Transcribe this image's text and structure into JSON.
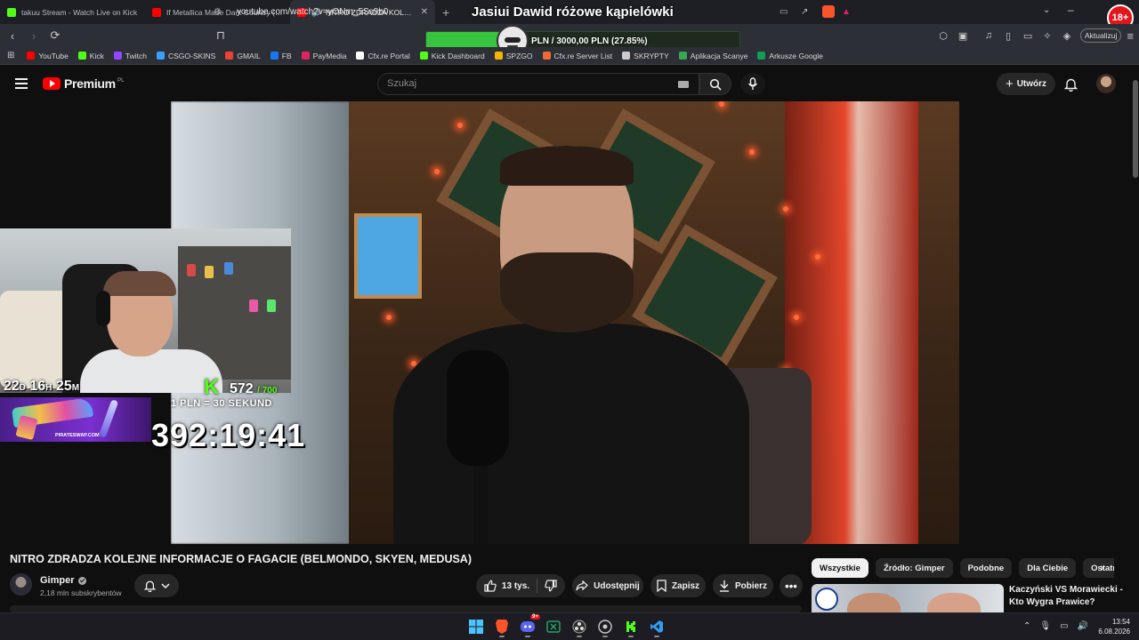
{
  "browser": {
    "tabs": [
      {
        "label": "takuu Stream - Watch Live on Kick",
        "favicon_color": "#53fc18",
        "active": false
      },
      {
        "label": "If Metallica Made Dark Country (Seen",
        "favicon_color": "#ff0000",
        "active": false
      },
      {
        "label": "NITRO ZDRADZA KOLEJNE IN",
        "favicon_color": "#ff0000",
        "active": true
      }
    ],
    "overlay_title": "Jasiui Dawid różowe kąpielówki",
    "age_badge": "18+",
    "url": "youtube.com/watch?v=yONm_5Ss9b0",
    "update_label": "Aktualizuj",
    "donation": {
      "label": "PLN / 3000,00 PLN  (27.85%)",
      "percent": 27.85
    },
    "bookmarks": [
      {
        "label": "YouTube",
        "color": "#ff0000"
      },
      {
        "label": "Kick",
        "color": "#53fc18"
      },
      {
        "label": "Twitch",
        "color": "#9146ff"
      },
      {
        "label": "CSGO-SKINS",
        "color": "#3aa0ff"
      },
      {
        "label": "GMAIL",
        "color": "#ea4335"
      },
      {
        "label": "FB",
        "color": "#1877f2"
      },
      {
        "label": "PayMedia",
        "color": "#e0245e"
      },
      {
        "label": "Cfx.re Portal",
        "color": "#ffffff"
      },
      {
        "label": "Kick Dashboard",
        "color": "#53fc18"
      },
      {
        "label": "SPZGO",
        "color": "#f4b400"
      },
      {
        "label": "Cfx.re Server List",
        "color": "#f06a35"
      },
      {
        "label": "SKRYPTY",
        "color": "#cccccc"
      },
      {
        "label": "Aplikacja Scanye",
        "color": "#34a853"
      },
      {
        "label": "Arkusze Google",
        "color": "#0f9d58"
      }
    ]
  },
  "youtube": {
    "logo_text": "Premium",
    "logo_region": "PL",
    "search_placeholder": "Szukaj",
    "create_label": "Utwórz",
    "video": {
      "title": "NITRO ZDRADZA KOLEJNE INFORMACJE O FAGACIE (BELMONDO, SKYEN, MEDUSA)",
      "channel": "Gimper",
      "subscribers": "2,18 mln subskrybentów",
      "likes": "13 tys.",
      "share_label": "Udostępnij",
      "save_label": "Zapisz",
      "download_label": "Pobierz"
    },
    "chips": [
      "Wszystkie",
      "Źródło: Gimper",
      "Podobne",
      "Dla Ciebie",
      "Ostatnio"
    ],
    "recommended": {
      "title": "Kaczyński VS Morawiecki - Kto Wygra Prawice?"
    }
  },
  "stream_overlay": {
    "days": "22",
    "days_unit": "D",
    "hours": "16",
    "hours_unit": "H",
    "minutes": "25",
    "minutes_unit": "M",
    "kick_followers": "572",
    "kick_goal": "/ 700",
    "rate": "1 PLN = 30 SEKUND",
    "timer": "392:19:41",
    "sponsor": "PIRATESWAP.COM"
  },
  "taskbar": {
    "time": "13:54",
    "date": "6.08.2026",
    "discord_badge": "9+"
  }
}
